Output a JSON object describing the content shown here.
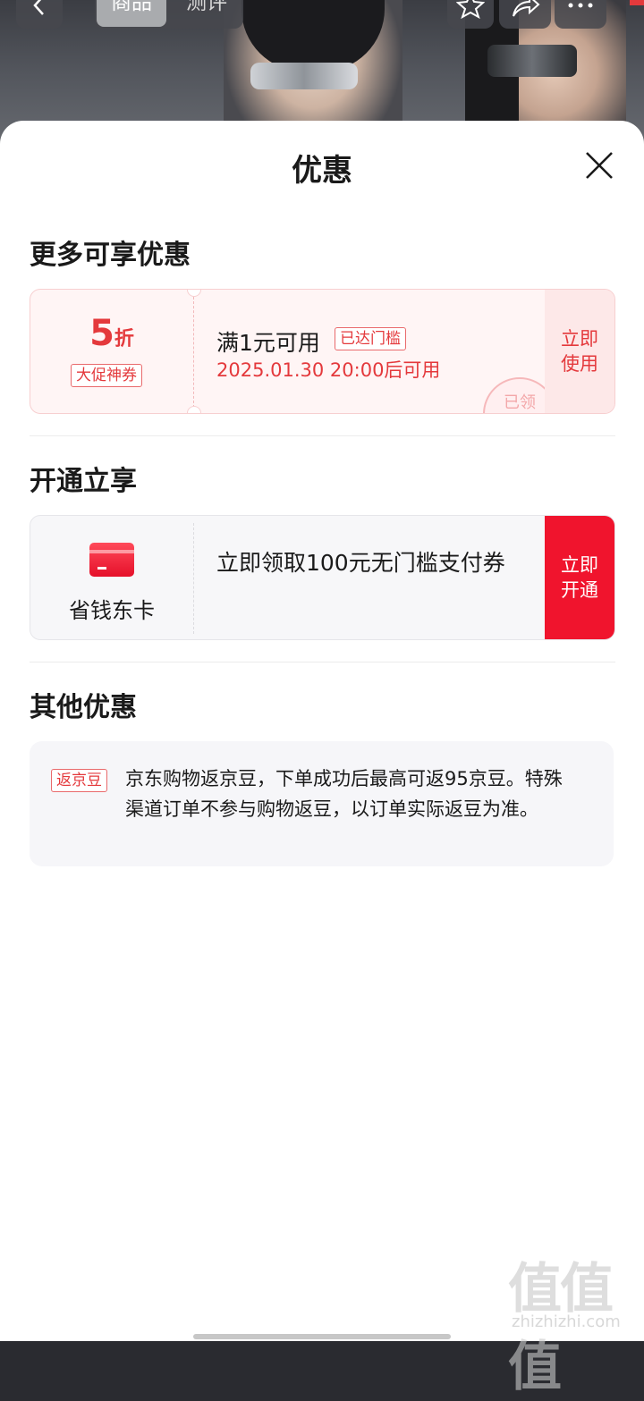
{
  "background_page": {
    "nav_back_icon": "chevron-left-icon",
    "tabs": [
      "商品",
      "测评"
    ],
    "right_icons": [
      "star-icon",
      "share-icon",
      "more-icon"
    ]
  },
  "sheet": {
    "title": "优惠",
    "close_icon": "close-icon",
    "sections": {
      "more": "更多可享优惠",
      "open": "开通立享",
      "other": "其他优惠"
    }
  },
  "coupon": {
    "discount_number": "5",
    "discount_unit": "折",
    "tag": "大促神券",
    "condition": "满1元可用",
    "reached_badge": "已达门槛",
    "time": "2025.01.30 20:00后可用",
    "stamp": "已领",
    "action": "立即使用",
    "colors": {
      "accent": "#e4393c",
      "bg": "#fff5f5"
    }
  },
  "membership": {
    "icon": "card-icon",
    "name": "省钱东卡",
    "description": "立即领取100元无门槛支付券",
    "action": "立即开通",
    "colors": {
      "button": "#f0142d"
    }
  },
  "other_offer": {
    "tag": "返京豆",
    "text": "京东购物返京豆，下单成功后最高可返95京豆。特殊渠道订单不参与购物返豆，以订单实际返豆为准。"
  },
  "watermark": {
    "glyphs": "值值值",
    "url": "zhizhizhi.com"
  }
}
